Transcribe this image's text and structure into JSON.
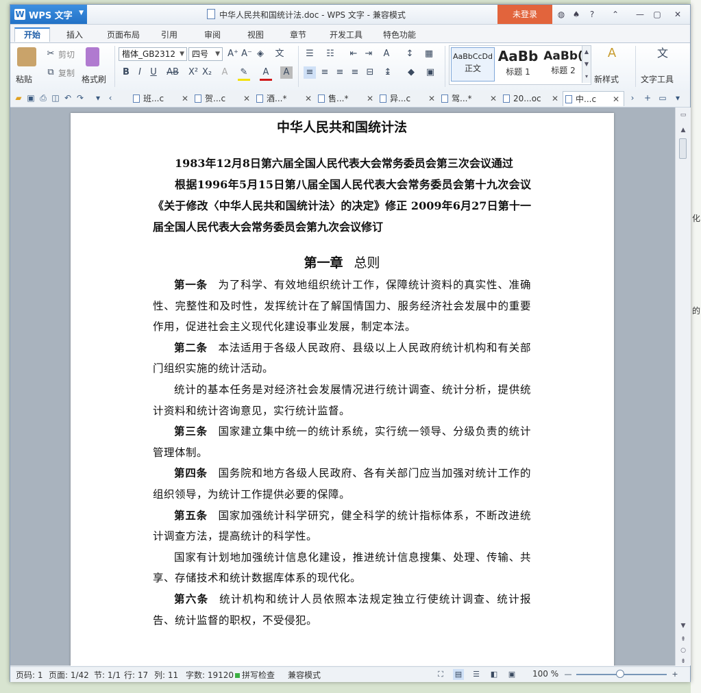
{
  "titlebar": {
    "app_name": "WPS 文字",
    "doc_title": "中华人民共和国统计法.doc - WPS 文字 - 兼容模式",
    "login_label": "未登录"
  },
  "menu": {
    "tabs": [
      "开始",
      "插入",
      "页面布局",
      "引用",
      "审阅",
      "视图",
      "章节",
      "开发工具",
      "特色功能"
    ]
  },
  "ribbon": {
    "paste": "粘贴",
    "cut": "剪切",
    "copy": "复制",
    "format_painter": "格式刷",
    "font_name": "楷体_GB2312",
    "font_size": "四号",
    "styles": [
      {
        "sample": "AaBbCcDd",
        "name": "正文"
      },
      {
        "sample": "AaBb",
        "name": "标题 1"
      },
      {
        "sample": "AaBb(",
        "name": "标题 2"
      }
    ],
    "new_style": "新样式",
    "text_tools": "文字工具"
  },
  "doc_tabs": [
    "班...c",
    "贺...c",
    "酒...*",
    "售...*",
    "异...c",
    "驾...*",
    "20...oc",
    "中...c"
  ],
  "document": {
    "title": "中华人民共和国统计法",
    "passage1": "1983年12月8日第六届全国人民代表大会常务委员会第三次会议通过",
    "passage2": "根据1996年5月15日第八届全国人民代表大会常务委员会第十九次会议《关于修改〈中华人民共和国统计法〉的决定》修正 2009年6月27日第十一届全国人民代表大会常务委员会第九次会议修订",
    "chapter_no": "第一章",
    "chapter_name": "总则",
    "articles": [
      {
        "no": "第一条",
        "text": "为了科学、有效地组织统计工作，保障统计资料的真实性、准确性、完整性和及时性，发挥统计在了解国情国力、服务经济社会发展中的重要作用，促进社会主义现代化建设事业发展，制定本法。"
      },
      {
        "no": "第二条",
        "text": "本法适用于各级人民政府、县级以上人民政府统计机构和有关部门组织实施的统计活动。"
      },
      {
        "no": "",
        "text": "统计的基本任务是对经济社会发展情况进行统计调查、统计分析，提供统计资料和统计咨询意见，实行统计监督。"
      },
      {
        "no": "第三条",
        "text": "国家建立集中统一的统计系统，实行统一领导、分级负责的统计管理体制。"
      },
      {
        "no": "第四条",
        "text": "国务院和地方各级人民政府、各有关部门应当加强对统计工作的组织领导，为统计工作提供必要的保障。"
      },
      {
        "no": "第五条",
        "text": "国家加强统计科学研究，健全科学的统计指标体系，不断改进统计调查方法，提高统计的科学性。"
      },
      {
        "no": "",
        "text": "国家有计划地加强统计信息化建设，推进统计信息搜集、处理、传输、共享、存储技术和统计数据库体系的现代化。"
      },
      {
        "no": "第六条",
        "text": "统计机构和统计人员依照本法规定独立行使统计调查、统计报告、统计监督的职权，不受侵犯。"
      }
    ]
  },
  "status": {
    "page_code": "页码: 1",
    "pages": "页面: 1/42",
    "section": "节: 1/1",
    "row": "行: 17",
    "col": "列: 11",
    "words": "字数: 19120",
    "spell": "拼写检查",
    "mode": "兼容模式",
    "zoom": "100 %"
  },
  "colors": {
    "app_blue": "#2271c6",
    "login_orange": "#e2643c",
    "spell_green": "#3cb043"
  },
  "background": {
    "side_text_1": "化",
    "side_text_2": "的"
  }
}
